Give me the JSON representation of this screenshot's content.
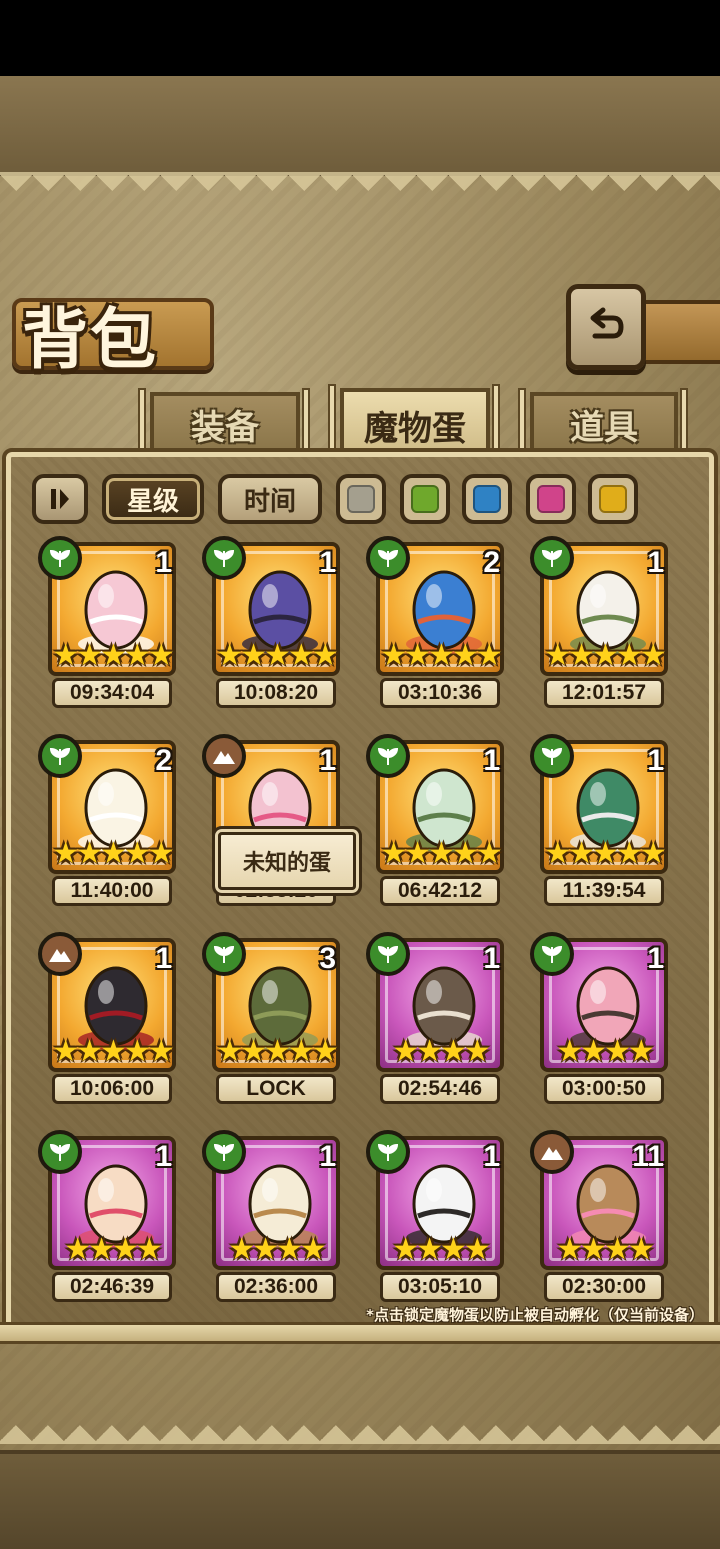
{
  "header": {
    "title": "背包"
  },
  "tabs": [
    {
      "label": "装备",
      "active": false
    },
    {
      "label": "魔物蛋",
      "active": true
    },
    {
      "label": "道具",
      "active": false
    }
  ],
  "sort": {
    "star_label": "星级",
    "time_label": "时间",
    "active": "星级"
  },
  "color_filters": [
    {
      "name": "gray",
      "color": "#a49f8e"
    },
    {
      "name": "green",
      "color": "#6fa82c"
    },
    {
      "name": "blue",
      "color": "#2f82c4"
    },
    {
      "name": "pink",
      "color": "#d0448a"
    },
    {
      "name": "yellow",
      "color": "#e0ad1a"
    }
  ],
  "eggs": [
    {
      "element": "grass",
      "count": "1",
      "stars": 5,
      "rarity": "gold",
      "timer": "09:34:04",
      "palette": [
        "#f6c8d4",
        "#ffffff"
      ]
    },
    {
      "element": "grass",
      "count": "1",
      "stars": 5,
      "rarity": "gold",
      "timer": "10:08:20",
      "palette": [
        "#5b4fa3",
        "#2c2540"
      ]
    },
    {
      "element": "grass",
      "count": "2",
      "stars": 5,
      "rarity": "gold",
      "timer": "03:10:36",
      "palette": [
        "#3b7fd2",
        "#e0623a"
      ]
    },
    {
      "element": "grass",
      "count": "1",
      "stars": 5,
      "rarity": "gold",
      "timer": "12:01:57",
      "palette": [
        "#f4f1ea",
        "#6e8a50"
      ]
    },
    {
      "element": "grass",
      "count": "2",
      "stars": 5,
      "rarity": "gold",
      "timer": "11:40:00",
      "palette": [
        "#faf4e4",
        "#ffffff"
      ]
    },
    {
      "element": "earth",
      "count": "1",
      "stars": 5,
      "rarity": "gold",
      "timer": "02:33:20",
      "palette": [
        "#f3c2d0",
        "#e55a86"
      ]
    },
    {
      "element": "grass",
      "count": "1",
      "stars": 5,
      "rarity": "gold",
      "timer": "06:42:12",
      "palette": [
        "#cfe6cf",
        "#5d7f4b"
      ]
    },
    {
      "element": "grass",
      "count": "1",
      "stars": 5,
      "rarity": "gold",
      "timer": "11:39:54",
      "palette": [
        "#3f8a66",
        "#eaeaea"
      ]
    },
    {
      "element": "earth",
      "count": "1",
      "stars": 5,
      "rarity": "gold",
      "timer": "10:06:00",
      "palette": [
        "#2e2a30",
        "#a11b24"
      ]
    },
    {
      "element": "grass",
      "count": "3",
      "stars": 5,
      "rarity": "gold",
      "timer": "LOCK",
      "palette": [
        "#5d6b3a",
        "#8e9b58"
      ]
    },
    {
      "element": "grass",
      "count": "1",
      "stars": 4,
      "rarity": "purple",
      "timer": "02:54:46",
      "palette": [
        "#6b5a4a",
        "#e9dfcf"
      ]
    },
    {
      "element": "grass",
      "count": "1",
      "stars": 4,
      "rarity": "purple",
      "timer": "03:00:50",
      "palette": [
        "#f1a6b8",
        "#4a3a34"
      ]
    },
    {
      "element": "grass",
      "count": "1",
      "stars": 4,
      "rarity": "purple",
      "timer": "02:46:39",
      "palette": [
        "#f7dcc4",
        "#e04f6a"
      ]
    },
    {
      "element": "grass",
      "count": "1",
      "stars": 4,
      "rarity": "purple",
      "timer": "02:36:00",
      "palette": [
        "#f5ecd6",
        "#b98a4e"
      ]
    },
    {
      "element": "grass",
      "count": "1",
      "stars": 4,
      "rarity": "purple",
      "timer": "03:05:10",
      "palette": [
        "#f4f4f4",
        "#2d2a28"
      ]
    },
    {
      "element": "earth",
      "count": "11",
      "stars": 4,
      "rarity": "purple",
      "timer": "02:30:00",
      "palette": [
        "#b88a5a",
        "#f58bb2"
      ]
    }
  ],
  "tooltip": {
    "text": "未知的蛋"
  },
  "footnote": "*点击锁定魔物蛋以防止被自动孵化（仅当前设备）"
}
